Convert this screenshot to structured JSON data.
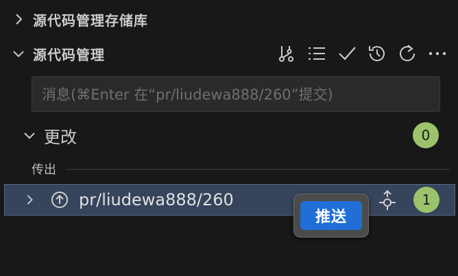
{
  "repos_section": {
    "title": "源代码管理存储库"
  },
  "scm_section": {
    "title": "源代码管理",
    "actions": [
      {
        "icon": "branch-graph-icon"
      },
      {
        "icon": "list-icon"
      },
      {
        "icon": "checkmark-icon"
      },
      {
        "icon": "history-icon"
      },
      {
        "icon": "refresh-icon"
      },
      {
        "icon": "more-icon"
      }
    ]
  },
  "commit_input": {
    "placeholder": "消息(⌘Enter 在“pr/liudewa888/260”提交)"
  },
  "changes": {
    "label": "更改",
    "count": "0"
  },
  "outgoing": {
    "label": "传出"
  },
  "branch": {
    "name": "pr/liudewa888/260",
    "count": "1"
  },
  "tooltip": {
    "label": "推送"
  },
  "colors": {
    "background": "#181818",
    "badge": "#9cc36b",
    "selection": "#36445c",
    "accent": "#1f6fd6"
  }
}
